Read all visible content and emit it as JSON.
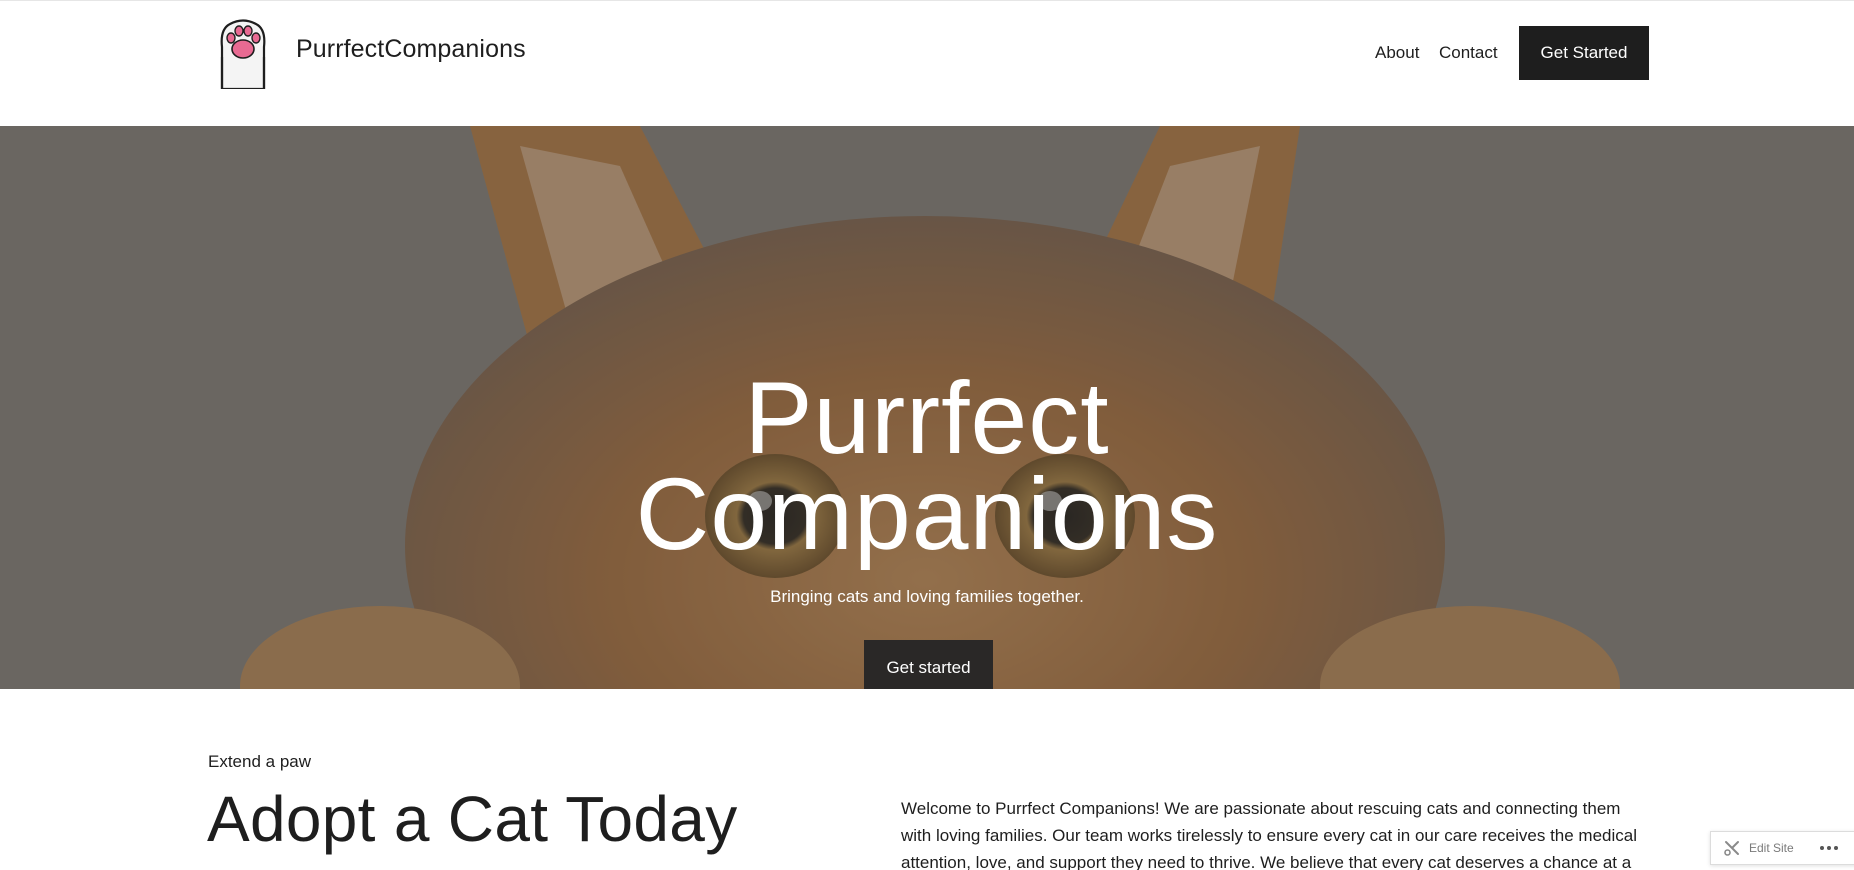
{
  "header": {
    "site_title": "PurrfectCompanions",
    "nav": [
      {
        "label": "About"
      },
      {
        "label": "Contact"
      }
    ],
    "cta_label": "Get Started",
    "logo_icon": "paw-icon"
  },
  "hero": {
    "title_line1": "Purrfect",
    "title_line2": "Companions",
    "subtitle": "Bringing cats and loving families together.",
    "cta_label": "Get started",
    "background": "orange-tabby-cat-photo"
  },
  "section": {
    "kicker": "Extend a paw",
    "title": "Adopt a Cat Today",
    "intro": "Welcome to Purrfect Companions! We are passionate about rescuing cats and connecting them with loving families. Our team works tirelessly to ensure every cat in our care receives the medical attention, love, and support they need to thrive. We believe that every cat deserves a chance at a"
  },
  "edit_widget": {
    "label": "Edit Site",
    "edit_icon": "tools-icon",
    "more_icon": "ellipsis-icon"
  },
  "colors": {
    "text": "#1e1e1e",
    "button_bg": "#1e1e1e",
    "hero_overlay": "#5d5955",
    "paw_pink": "#e86a92"
  }
}
